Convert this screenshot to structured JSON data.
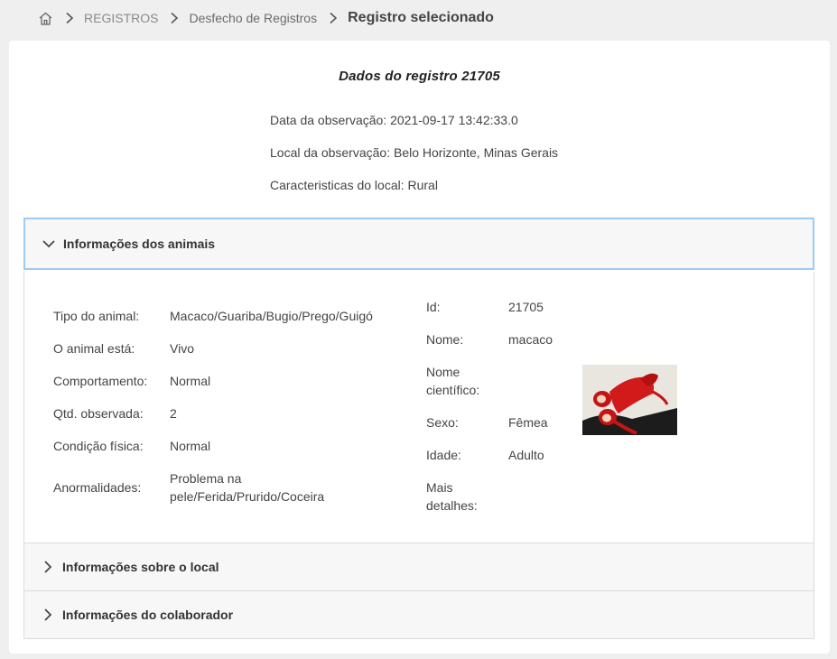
{
  "breadcrumb": {
    "items": [
      "REGISTROS",
      "Desfecho de Registros",
      "Registro selecionado"
    ]
  },
  "record": {
    "title": "Dados do registro 21705",
    "observation_date": "Data da observação: 2021-09-17 13:42:33.0",
    "observation_place": "Local da observação: Belo Horizonte, Minas Gerais",
    "place_features": "Caracteristicas do local: Rural"
  },
  "accordion": {
    "animals": {
      "label": "Informações dos animais",
      "expanded": true
    },
    "place": {
      "label": "Informações sobre o local",
      "expanded": false
    },
    "collaborator": {
      "label": "Informações do colaborador",
      "expanded": false
    }
  },
  "animal_left": [
    {
      "label": "Tipo do animal:",
      "value": "Macaco/Guariba/Bugio/Prego/Guigó"
    },
    {
      "label": "O animal está:",
      "value": "Vivo"
    },
    {
      "label": "Comportamento:",
      "value": "Normal"
    },
    {
      "label": "Qtd. observada:",
      "value": "2"
    },
    {
      "label": "Condição física:",
      "value": "Normal"
    },
    {
      "label": "Anormalidades:",
      "value_line1": "Problema na",
      "value_line2": "pele/Ferida/Prurido/Coceira"
    }
  ],
  "animal_right": {
    "id": {
      "label": "Id:",
      "value": "21705"
    },
    "name": {
      "label": "Nome:",
      "value": "macaco"
    },
    "scientific": {
      "label_line1": "Nome",
      "label_line2": "científico:",
      "value": ""
    },
    "sex": {
      "label": "Sexo:",
      "value": "Fêmea"
    },
    "age": {
      "label": "Idade:",
      "value": "Adulto"
    },
    "details": {
      "label_line1": "Mais",
      "label_line2": "detalhes:",
      "value": ""
    }
  },
  "icons": {
    "home": "home-icon",
    "separator": "chevron-right-icon",
    "expanded": "chevron-down-icon",
    "collapsed": "chevron-right-icon"
  },
  "colors": {
    "active_border": "#9ecbf3",
    "header_bg": "#f7f7f7",
    "page_bg": "#efefef"
  }
}
